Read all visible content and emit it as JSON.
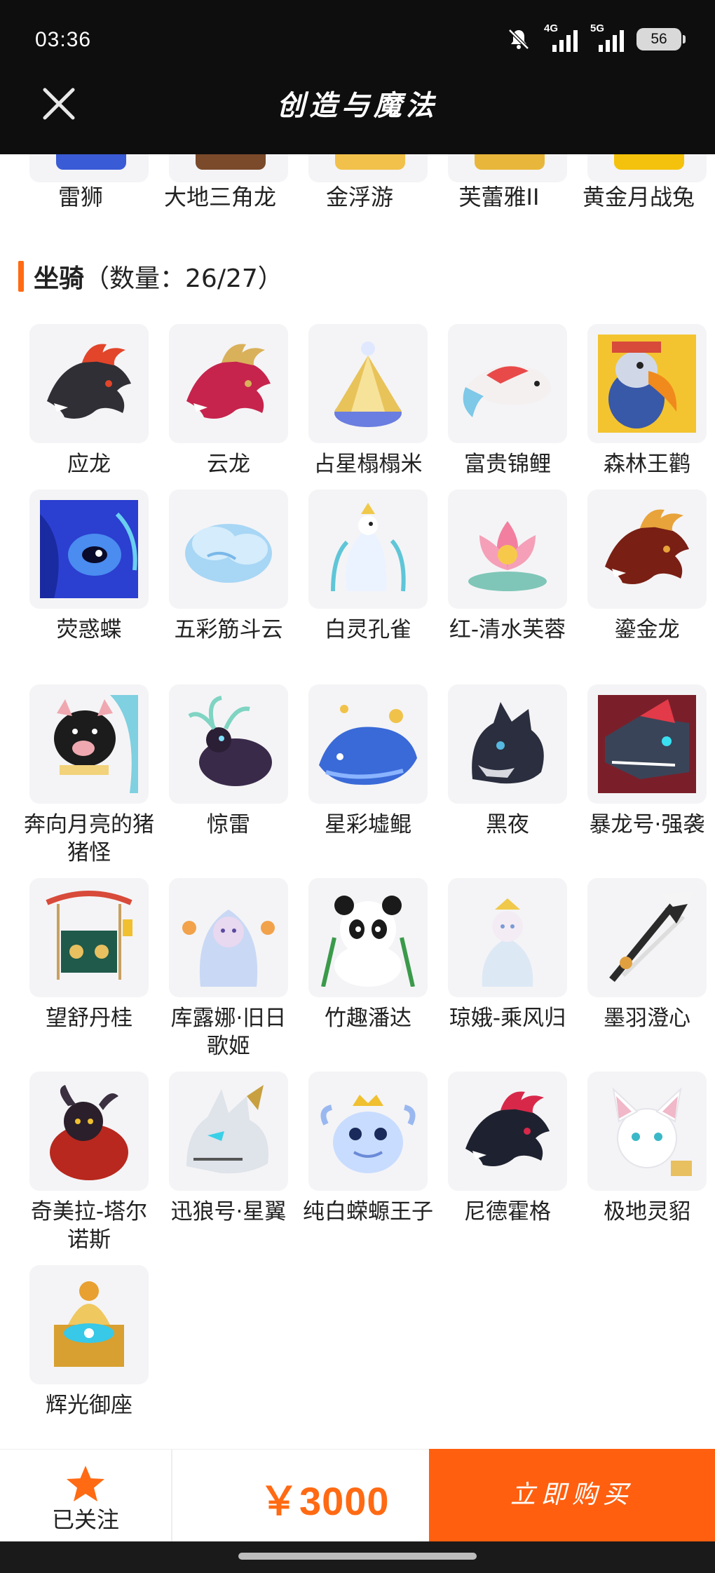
{
  "status_bar": {
    "time": "03:36",
    "signal_1_label": "4G",
    "signal_2_label": "5G",
    "battery": "56"
  },
  "header": {
    "title": "创造与魔法"
  },
  "top_row": [
    {
      "label": "雷狮",
      "icon": "lion-icon",
      "color": "#3a5bd6"
    },
    {
      "label": "大地三角龙",
      "icon": "triceratops-icon",
      "color": "#7a4a2a"
    },
    {
      "label": "金浮游",
      "icon": "gold-float-icon",
      "color": "#f2c14b"
    },
    {
      "label": "芙蕾雅II",
      "icon": "freya-icon",
      "color": "#e8b63a"
    },
    {
      "label": "黄金月战兔",
      "icon": "golden-rabbit-icon",
      "color": "#f4c20d"
    }
  ],
  "section": {
    "title": "坐骑",
    "count_text": "（数量：26/27）"
  },
  "mounts": [
    {
      "label": "应龙",
      "icon": "dragon-icon",
      "c1": "#2f2f35",
      "c2": "#e2452a"
    },
    {
      "label": "云龙",
      "icon": "dragon-icon",
      "c1": "#c6244d",
      "c2": "#d9b15a"
    },
    {
      "label": "占星榻榻米",
      "icon": "crystal-icon",
      "c1": "#e8c35a",
      "c2": "#6a7de0"
    },
    {
      "label": "富贵锦鲤",
      "icon": "koi-icon",
      "c1": "#e84a4a",
      "c2": "#7ec8e8"
    },
    {
      "label": "森林王鹳",
      "icon": "stork-icon",
      "c1": "#3858a8",
      "c2": "#f08a1c"
    },
    {
      "label": "荧惑蝶",
      "icon": "butterfly-icon",
      "c1": "#2b3fd0",
      "c2": "#6ad0f0"
    },
    {
      "label": "五彩筋斗云",
      "icon": "cloud-icon",
      "c1": "#a8d6f5",
      "c2": "#d4ecfb"
    },
    {
      "label": "白灵孔雀",
      "icon": "peacock-icon",
      "c1": "#eaf3ff",
      "c2": "#5fc6d8"
    },
    {
      "label": "红-清水芙蓉",
      "icon": "lotus-icon",
      "c1": "#f27fa0",
      "c2": "#f7c94b"
    },
    {
      "label": "鎏金龙",
      "icon": "dragon-icon",
      "c1": "#7a1f14",
      "c2": "#e8a33a"
    },
    {
      "label": "奔向月亮的猪猪怪",
      "icon": "pig-icon",
      "c1": "#1c1c1c",
      "c2": "#f2d27a"
    },
    {
      "label": "惊雷",
      "icon": "stag-icon",
      "c1": "#3a2a4a",
      "c2": "#7fd4c2"
    },
    {
      "label": "星彩墟鲲",
      "icon": "whale-icon",
      "c1": "#3a6ad8",
      "c2": "#f0c24a"
    },
    {
      "label": "黑夜",
      "icon": "wolf-icon",
      "c1": "#2a2e3e",
      "c2": "#56b8e0"
    },
    {
      "label": "暴龙号·强袭",
      "icon": "mecha-icon",
      "c1": "#3a4458",
      "c2": "#e23a48"
    },
    {
      "label": "望舒丹桂",
      "icon": "swing-icon",
      "c1": "#1f5a4a",
      "c2": "#d84a3a"
    },
    {
      "label": "库露娜·旧日歌姬",
      "icon": "singer-icon",
      "c1": "#c9d8f5",
      "c2": "#f2a24a"
    },
    {
      "label": "竹趣潘达",
      "icon": "panda-icon",
      "c1": "#1a1a1a",
      "c2": "#ffffff"
    },
    {
      "label": "琼娥-乘风归",
      "icon": "fairy-icon",
      "c1": "#dde8f5",
      "c2": "#f0c84a"
    },
    {
      "label": "墨羽澄心",
      "icon": "sword-icon",
      "c1": "#2a2a2a",
      "c2": "#e0a040"
    },
    {
      "label": "奇美拉-塔尔诺斯",
      "icon": "chimera-icon",
      "c1": "#b8281e",
      "c2": "#2a1f2a"
    },
    {
      "label": "迅狼号·星翼",
      "icon": "mecha-wolf-icon",
      "c1": "#dfe3ea",
      "c2": "#3ad0e8"
    },
    {
      "label": "纯白蝾螈王子",
      "icon": "axolotl-icon",
      "c1": "#c8dcff",
      "c2": "#f0c030"
    },
    {
      "label": "尼德霍格",
      "icon": "dragon-icon",
      "c1": "#1e2230",
      "c2": "#d8284a"
    },
    {
      "label": "极地灵貂",
      "icon": "fox-icon",
      "c1": "#ffffff",
      "c2": "#e8c060"
    },
    {
      "label": "辉光御座",
      "icon": "throne-icon",
      "c1": "#d8a030",
      "c2": "#38c8e8"
    }
  ],
  "bottom_bar": {
    "follow_label": "已关注",
    "price": "￥3000",
    "buy_label": "立即购买"
  },
  "colors": {
    "accent": "#ff6a13",
    "header_bg": "#0e0e0e"
  }
}
